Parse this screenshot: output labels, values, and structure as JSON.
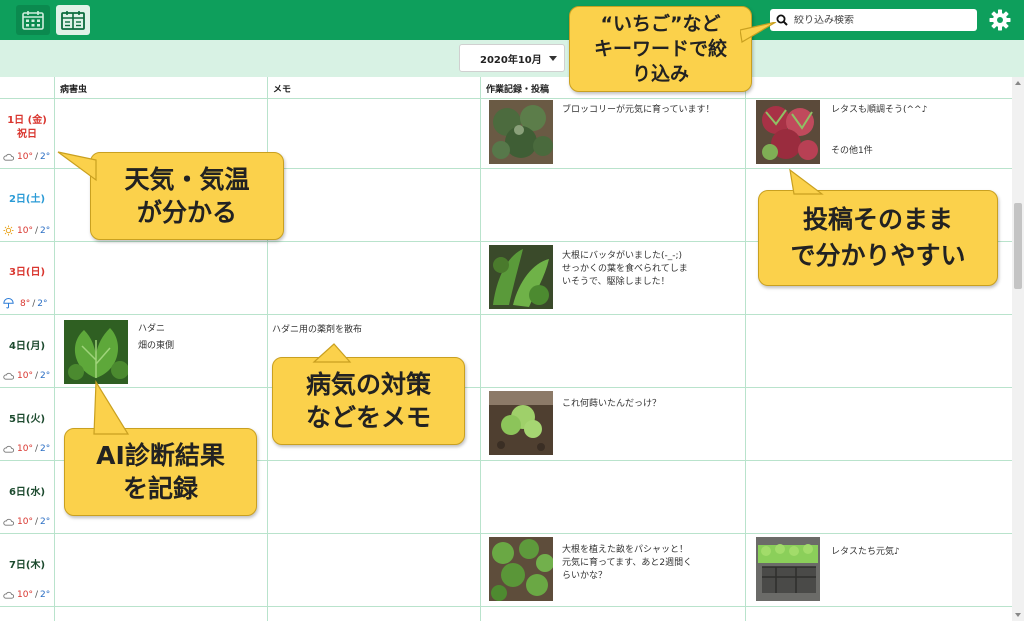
{
  "toolbar": {
    "calendar_view_icon": "calendar-icon",
    "table_view_icon": "table-view-icon",
    "settings_icon": "gear-icon",
    "accent_color": "#0e9f5c"
  },
  "search": {
    "placeholder": "絞り込み検索",
    "icon": "search-icon"
  },
  "month_selector": {
    "value": "2020年10月"
  },
  "columns": [
    "病害虫",
    "メモ",
    "作業記録・投稿"
  ],
  "days": [
    {
      "label": "1日 (金)",
      "sub": "祝日",
      "weather_icon": "cloud-icon",
      "hi": "10°",
      "lo": "2°",
      "color": "#d9362f"
    },
    {
      "label": "2日(土)",
      "sub": "",
      "weather_icon": "sun-icon",
      "hi": "10°",
      "lo": "2°",
      "color": "#2b9bd6"
    },
    {
      "label": "3日(日)",
      "sub": "",
      "weather_icon": "umbrella-icon",
      "hi": "8°",
      "lo": "2°",
      "color": "#d9362f"
    },
    {
      "label": "4日(月)",
      "sub": "",
      "weather_icon": "cloud-icon",
      "hi": "10°",
      "lo": "2°",
      "color": "#1c4a2e"
    },
    {
      "label": "5日(火)",
      "sub": "",
      "weather_icon": "cloud-icon",
      "hi": "10°",
      "lo": "2°",
      "color": "#1c4a2e"
    },
    {
      "label": "6日(水)",
      "sub": "",
      "weather_icon": "cloud-icon",
      "hi": "10°",
      "lo": "2°",
      "color": "#1c4a2e"
    },
    {
      "label": "7日(木)",
      "sub": "",
      "weather_icon": "cloud-icon",
      "hi": "10°",
      "lo": "2°",
      "color": "#1c4a2e"
    }
  ],
  "pests": {
    "day4": {
      "name": "ハダニ",
      "location": "畑の東側",
      "image": "strawberry-leaf-photo"
    }
  },
  "memos": {
    "day4": "ハダニ用の薬剤を散布"
  },
  "posts": {
    "day1a": {
      "text": "ブロッコリーが元気に育っています！",
      "image": "broccoli-photo"
    },
    "day1b": {
      "text": "レタスも順調そう(^^♪",
      "more": "その他1件",
      "image": "lettuce-photo"
    },
    "day3": {
      "text": "大根にバッタがいました(-_-;)\nせっかくの葉を食べられてしま\nいそうで、駆除しました！",
      "image": "radish-leaf-photo"
    },
    "day5": {
      "text": "これ何蒔いたんだっけ？",
      "image": "seedling-photo"
    },
    "day7a": {
      "text": "大根を植えた畝をパシャッと！\n元気に育ってます、あと2週間く\nらいかな？",
      "image": "radish-bed-photo"
    },
    "day7b": {
      "text": "レタスたち元気♪",
      "image": "lettuce-tray-photo"
    }
  },
  "callouts": {
    "search": "“いちご”など\nキーワードで絞\nり込み",
    "weather": "天気・気温\nが分かる",
    "posts": "投稿そのまま\nで分かりやすい",
    "memo": "病気の対策\nなどをメモ",
    "ai": "AI診断結果\nを記録"
  }
}
